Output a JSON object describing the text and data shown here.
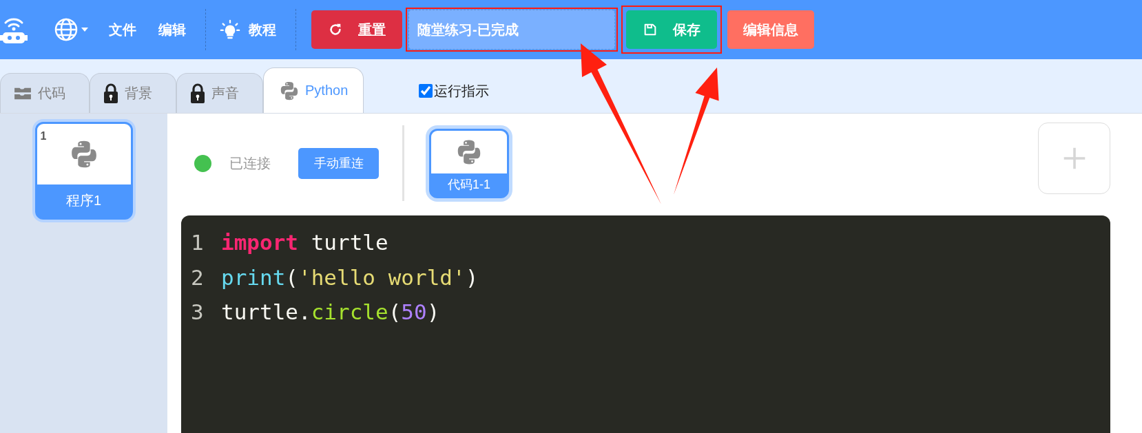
{
  "toolbar": {
    "menus": [
      {
        "label": "文件"
      },
      {
        "label": "编辑"
      }
    ],
    "tutorial": {
      "label": "教程"
    },
    "reset_button": {
      "label": "重置"
    },
    "title_field": {
      "value": "随堂练习-已完成",
      "highlighted": true
    },
    "save_button": {
      "label": "保存",
      "highlighted": true
    },
    "info_button": {
      "label": "编辑信息"
    }
  },
  "tabs": [
    {
      "label": "代码",
      "kind": "blocks",
      "selected": false
    },
    {
      "label": "背景",
      "kind": "lock",
      "selected": false
    },
    {
      "label": "声音",
      "kind": "lock",
      "selected": false
    },
    {
      "label": "Python",
      "kind": "python",
      "selected": true
    }
  ],
  "run_hint": {
    "label": "运行指示",
    "checked": true
  },
  "programs": [
    {
      "number": "1",
      "name": "程序1",
      "selected": true
    }
  ],
  "connection": {
    "connected": true,
    "label": "已连接",
    "reconnect_button": "手动重连"
  },
  "code_tabs": [
    {
      "label": "代码1-1",
      "selected": true
    }
  ],
  "editor": {
    "lines": [
      {
        "number": "1",
        "tokens": [
          {
            "kind": "keyword",
            "text": "import"
          },
          {
            "kind": "plain",
            "text": " turtle"
          }
        ]
      },
      {
        "number": "2",
        "tokens": [
          {
            "kind": "builtin",
            "text": "print"
          },
          {
            "kind": "plain",
            "text": "("
          },
          {
            "kind": "string",
            "text": "'hello world'"
          },
          {
            "kind": "plain",
            "text": ")"
          }
        ]
      },
      {
        "number": "3",
        "tokens": [
          {
            "kind": "plain",
            "text": "turtle."
          },
          {
            "kind": "func",
            "text": "circle"
          },
          {
            "kind": "plain",
            "text": "("
          },
          {
            "kind": "number",
            "text": "50"
          },
          {
            "kind": "plain",
            "text": ")"
          }
        ]
      }
    ]
  }
}
